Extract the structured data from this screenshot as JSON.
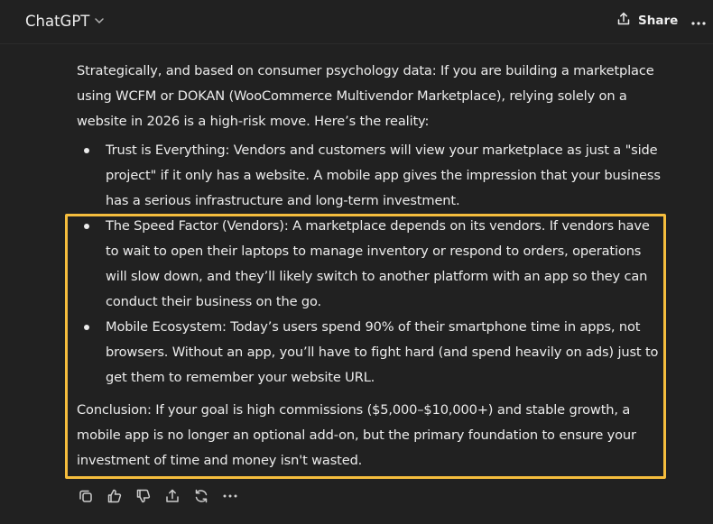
{
  "header": {
    "model_name": "ChatGPT",
    "share_label": "Share",
    "icons": {
      "model_dropdown": "chevron-down-icon",
      "share": "share-icon",
      "more": "more-horizontal-icon"
    }
  },
  "message": {
    "intro": "Strategically, and based on consumer psychology data: If you are building a marketplace using WCFM or DOKAN (WooCommerce Multivendor Marketplace), relying solely on a website in 2026 is a high-risk move. Here’s the reality:",
    "bullets": [
      "Trust is Everything: Vendors and customers will view your marketplace as just a \"side project\" if it only has a website. A mobile app gives the impression that your business has a serious infrastructure and long-term investment.",
      "The Speed Factor (Vendors): A marketplace depends on its vendors. If vendors have to wait to open their laptops to manage inventory or respond to orders, operations will slow down, and they’ll likely switch to another platform with an app so they can conduct their business on the go.",
      "Mobile Ecosystem: Today’s users spend 90% of their smartphone time in apps, not browsers. Without an app, you’ll have to fight hard (and spend heavily on ads) just to get them to remember your website URL."
    ],
    "conclusion": "Conclusion: If your goal is high commissions ($5,000–$10,000+) and stable growth, a mobile app is no longer an optional add-on, but the primary foundation to ensure your investment of time and money isn't wasted."
  },
  "highlight": {
    "color": "#f5bd3d"
  },
  "actions": {
    "icons": [
      "copy-icon",
      "thumbs-up-icon",
      "thumbs-down-icon",
      "share-icon",
      "regenerate-icon",
      "more-horizontal-icon"
    ]
  },
  "colors": {
    "background": "#212121",
    "text": "#ececec",
    "icon": "#cdcdcd"
  }
}
